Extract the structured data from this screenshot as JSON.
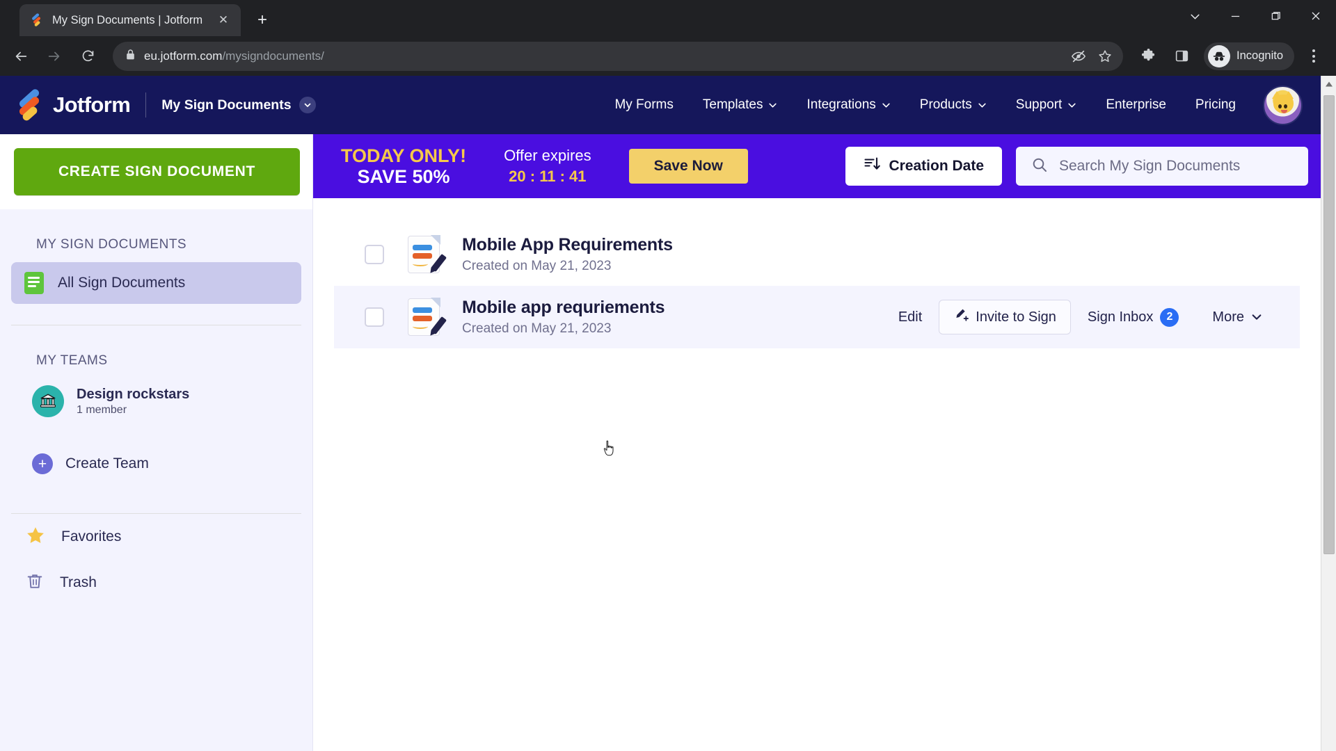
{
  "browser": {
    "tab": {
      "title": "My Sign Documents | Jotform",
      "favicon": "jotform-favicon",
      "close_label": "✕"
    },
    "new_tab_label": "+",
    "window_controls": [
      {
        "name": "tab-search",
        "glyph": "⌄"
      },
      {
        "name": "minimize",
        "glyph": "—"
      },
      {
        "name": "maximize",
        "glyph": "❐"
      },
      {
        "name": "close",
        "glyph": "✕"
      }
    ],
    "nav": {
      "back": "←",
      "forward": "→",
      "reload": "↻"
    },
    "url_domain": "eu.jotform.com",
    "url_path": "/mysigndocuments/",
    "omnibox_icons": [
      "lock-icon",
      "eye-off-icon",
      "bookmark-star-icon"
    ],
    "toolbar_icons": [
      "extensions-puzzle-icon",
      "side-panel-icon"
    ],
    "incognito_label": "Incognito",
    "menu_label": "chrome-menu"
  },
  "topnav": {
    "brand": "Jotform",
    "section": "My Sign Documents",
    "items": [
      {
        "label": "My Forms",
        "has_caret": false
      },
      {
        "label": "Templates",
        "has_caret": true
      },
      {
        "label": "Integrations",
        "has_caret": true
      },
      {
        "label": "Products",
        "has_caret": true
      },
      {
        "label": "Support",
        "has_caret": true
      },
      {
        "label": "Enterprise",
        "has_caret": false
      },
      {
        "label": "Pricing",
        "has_caret": false
      }
    ],
    "avatar": "user-avatar"
  },
  "sidebar": {
    "create_button": "CREATE SIGN DOCUMENT",
    "section_documents": "MY SIGN DOCUMENTS",
    "all_documents": "All Sign Documents",
    "section_teams": "MY TEAMS",
    "team": {
      "name": "Design rockstars",
      "members": "1 member"
    },
    "create_team": "Create Team",
    "favorites": "Favorites",
    "trash": "Trash"
  },
  "promo": {
    "headline": "TODAY ONLY!",
    "subline": "SAVE 50%",
    "expires_label": "Offer expires",
    "countdown": "20 : 11 : 41",
    "cta": "Save Now",
    "bg_color": "#4a0ee0",
    "accent_color": "#f6c94a"
  },
  "toolbar": {
    "sort_label": "Creation Date",
    "search_placeholder": "Search My Sign Documents"
  },
  "documents": [
    {
      "title": "Mobile App Requirements",
      "subtitle": "Created on May 21, 2023",
      "selected": false,
      "hovered": false,
      "actions": []
    },
    {
      "title": "Mobile app requriements",
      "subtitle": "Created on May 21, 2023",
      "selected": false,
      "hovered": true,
      "actions": [
        {
          "label": "Edit",
          "style": "plain"
        },
        {
          "label": "Invite to Sign",
          "style": "boxed",
          "icon": "pen-plus-icon"
        },
        {
          "label": "Sign Inbox",
          "style": "plain",
          "badge": "2"
        },
        {
          "label": "More",
          "style": "plain",
          "caret": true
        }
      ]
    }
  ],
  "colors": {
    "nav_bg": "#15175b",
    "create_green": "#5fa80f",
    "sidebar_bg": "#f3f3fe",
    "badge_blue": "#2a6df4",
    "team_avatar": "#2bb3ab"
  }
}
